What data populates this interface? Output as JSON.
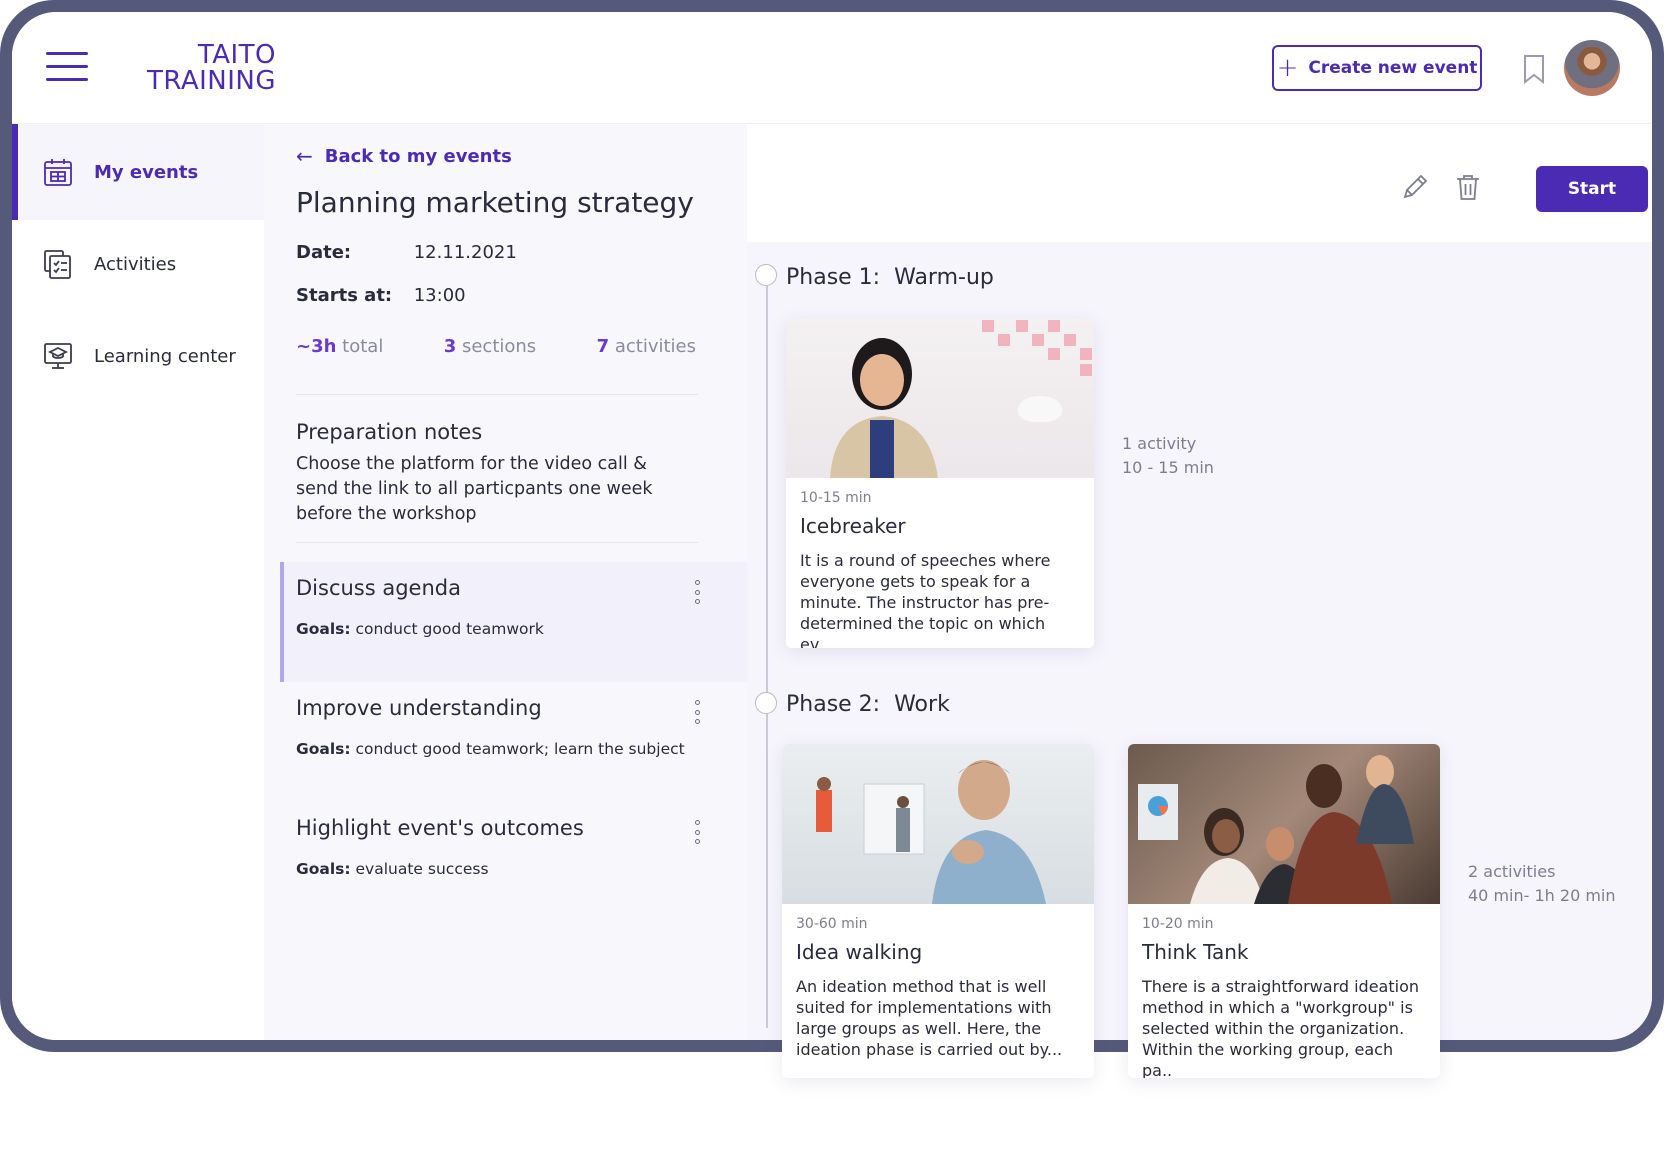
{
  "header": {
    "logo_line1": "TAITO",
    "logo_line2": "TRAINING",
    "create_label": "Create new event"
  },
  "sidebar": {
    "items": [
      {
        "label": "My events",
        "icon": "calendar-icon",
        "active": true
      },
      {
        "label": "Activities",
        "icon": "checklist-icon",
        "active": false
      },
      {
        "label": "Learning center",
        "icon": "graduation-screen-icon",
        "active": false
      }
    ]
  },
  "event": {
    "back_label": "Back to my events",
    "title": "Planning marketing strategy",
    "date_label": "Date:",
    "date_value": "12.11.2021",
    "start_label": "Starts at:",
    "start_value": "13:00",
    "stats": {
      "total_num": "~3h",
      "total_unit": "total",
      "sections_num": "3",
      "sections_unit": "sections",
      "activities_num": "7",
      "activities_unit": "activities"
    },
    "prep_title": "Preparation notes",
    "prep_text": "Choose the platform for the video call & send the link to all particpants one week before the workshop",
    "goals_label": "Goals:",
    "sections": [
      {
        "title": "Discuss agenda",
        "goals": "conduct good teamwork"
      },
      {
        "title": "Improve understanding",
        "goals": "conduct good teamwork; learn the subject"
      },
      {
        "title": "Highlight event's outcomes",
        "goals": "evaluate success"
      }
    ],
    "start_label_btn": "Start"
  },
  "phases": [
    {
      "label": "Phase 1:",
      "name": "Warm-up",
      "count": "1 activity",
      "duration": "10 - 15 min",
      "cards": [
        {
          "dur": "10-15 min",
          "title": "Icebreaker",
          "desc": "It is a round of speeches where everyone gets to speak for a minute. The instructor has pre-determined the topic on which ev..."
        }
      ]
    },
    {
      "label": "Phase 2:",
      "name": "Work",
      "count": "2 activities",
      "duration": "40 min- 1h 20 min",
      "cards": [
        {
          "dur": "30-60 min",
          "title": "Idea walking",
          "desc": "An ideation method that is well suited for implementations with large groups as well. Here, the ideation phase is carried out by..."
        },
        {
          "dur": "10-20 min",
          "title": "Think Tank",
          "desc": "There is a straightforward ideation method in which a \"workgroup\" is selected within the organization. Within the working group, each pa.."
        }
      ]
    }
  ],
  "colors": {
    "brand": "#4b2bb3",
    "accent": "#6a3ad0",
    "frame": "#55597a"
  }
}
